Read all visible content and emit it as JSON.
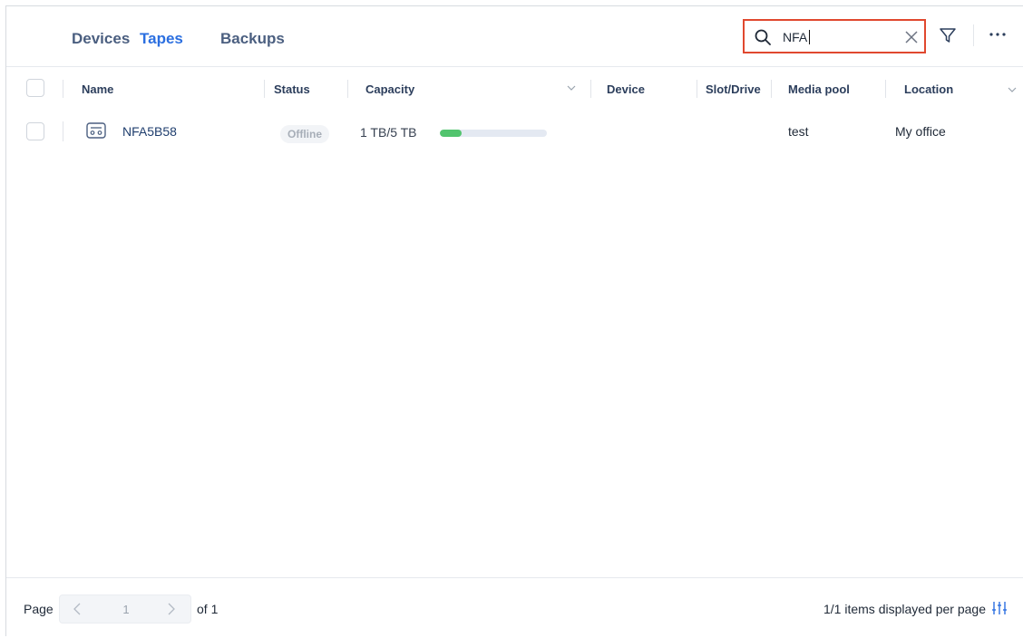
{
  "tabs": [
    {
      "label": "Devices",
      "active": false
    },
    {
      "label": "Tapes",
      "active": true
    },
    {
      "label": "Backups",
      "active": false
    }
  ],
  "search": {
    "value": "NFA",
    "placeholder": "",
    "highlight_color": "#e0482f"
  },
  "toolbar": {
    "filter_icon": "filter-icon",
    "more_icon": "more-icon"
  },
  "table": {
    "columns": [
      "Name",
      "Status",
      "Capacity",
      "Device",
      "Slot/Drive",
      "Media pool",
      "Location"
    ],
    "rows": [
      {
        "name": "NFA5B58",
        "status": "Offline",
        "capacity_text": "1 TB/5 TB",
        "capacity_used_fraction": 0.2,
        "device": "",
        "slot_drive": "",
        "media_pool": "test",
        "location": "My office"
      }
    ]
  },
  "footer": {
    "page_label": "Page",
    "current_page": "1",
    "of_label": "of 1",
    "items_label": "1/1 items displayed per page"
  },
  "colors": {
    "accent": "#2b6fe0",
    "progress": "#52c46e",
    "tab_inactive": "#4b5f80"
  }
}
